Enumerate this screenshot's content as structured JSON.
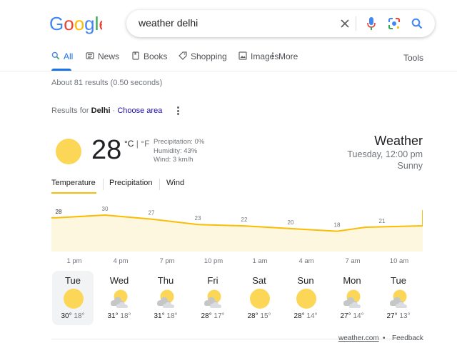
{
  "search": {
    "query": "weather delhi"
  },
  "tabs": [
    {
      "label": "All"
    },
    {
      "label": "News"
    },
    {
      "label": "Books"
    },
    {
      "label": "Shopping"
    },
    {
      "label": "Images"
    },
    {
      "label": "More"
    }
  ],
  "tools_label": "Tools",
  "result_stats": "About 81 results (0.50 seconds)",
  "results_for": {
    "prefix": "Results for ",
    "place": "Delhi",
    "separator": " · ",
    "choose": "Choose area"
  },
  "weather": {
    "temperature": "28",
    "unit_c": "°C",
    "unit_sep": " | ",
    "unit_f": "°F",
    "precipitation": "Precipitation: 0%",
    "humidity": "Humidity: 43%",
    "wind": "Wind: 3 km/h",
    "title": "Weather",
    "datetime": "Tuesday, 12:00 pm",
    "condition": "Sunny",
    "tabs": [
      "Temperature",
      "Precipitation",
      "Wind"
    ],
    "colors": {
      "sun": "#fcd757",
      "chart_line": "#fbbc04",
      "chart_fill": "#fef7e0"
    }
  },
  "chart_data": {
    "type": "area",
    "title": "",
    "xlabel": "",
    "ylabel": "",
    "categories": [
      "1 pm",
      "4 pm",
      "7 pm",
      "10 pm",
      "1 am",
      "4 am",
      "7 am",
      "10 am"
    ],
    "x": [
      "12 pm",
      "1 pm",
      "4 pm",
      "7 pm",
      "10 pm",
      "1 am",
      "4 am",
      "7 am",
      "10 am"
    ],
    "series": [
      {
        "values": [
          28,
          28,
          30,
          27,
          23,
          22,
          20,
          18,
          21
        ]
      }
    ],
    "labels": [
      "28",
      "30",
      "27",
      "23",
      "22",
      "20",
      "18",
      "21"
    ],
    "grid": false,
    "legend": "none"
  },
  "forecast": [
    {
      "day": "Tue",
      "icon": "sunny-icon",
      "high": "30°",
      "low": "18°"
    },
    {
      "day": "Wed",
      "icon": "partly-cloudy-icon",
      "high": "31°",
      "low": "18°"
    },
    {
      "day": "Thu",
      "icon": "partly-cloudy-icon",
      "high": "31°",
      "low": "18°"
    },
    {
      "day": "Fri",
      "icon": "partly-cloudy-icon",
      "high": "28°",
      "low": "17°"
    },
    {
      "day": "Sat",
      "icon": "sunny-icon",
      "high": "28°",
      "low": "15°"
    },
    {
      "day": "Sun",
      "icon": "sunny-icon",
      "high": "28°",
      "low": "14°"
    },
    {
      "day": "Mon",
      "icon": "partly-cloudy-icon",
      "high": "27°",
      "low": "14°"
    },
    {
      "day": "Tue",
      "icon": "partly-cloudy-icon",
      "high": "27°",
      "low": "13°"
    }
  ],
  "footer": {
    "source": "weather.com",
    "dot": "•",
    "feedback": "Feedback"
  }
}
